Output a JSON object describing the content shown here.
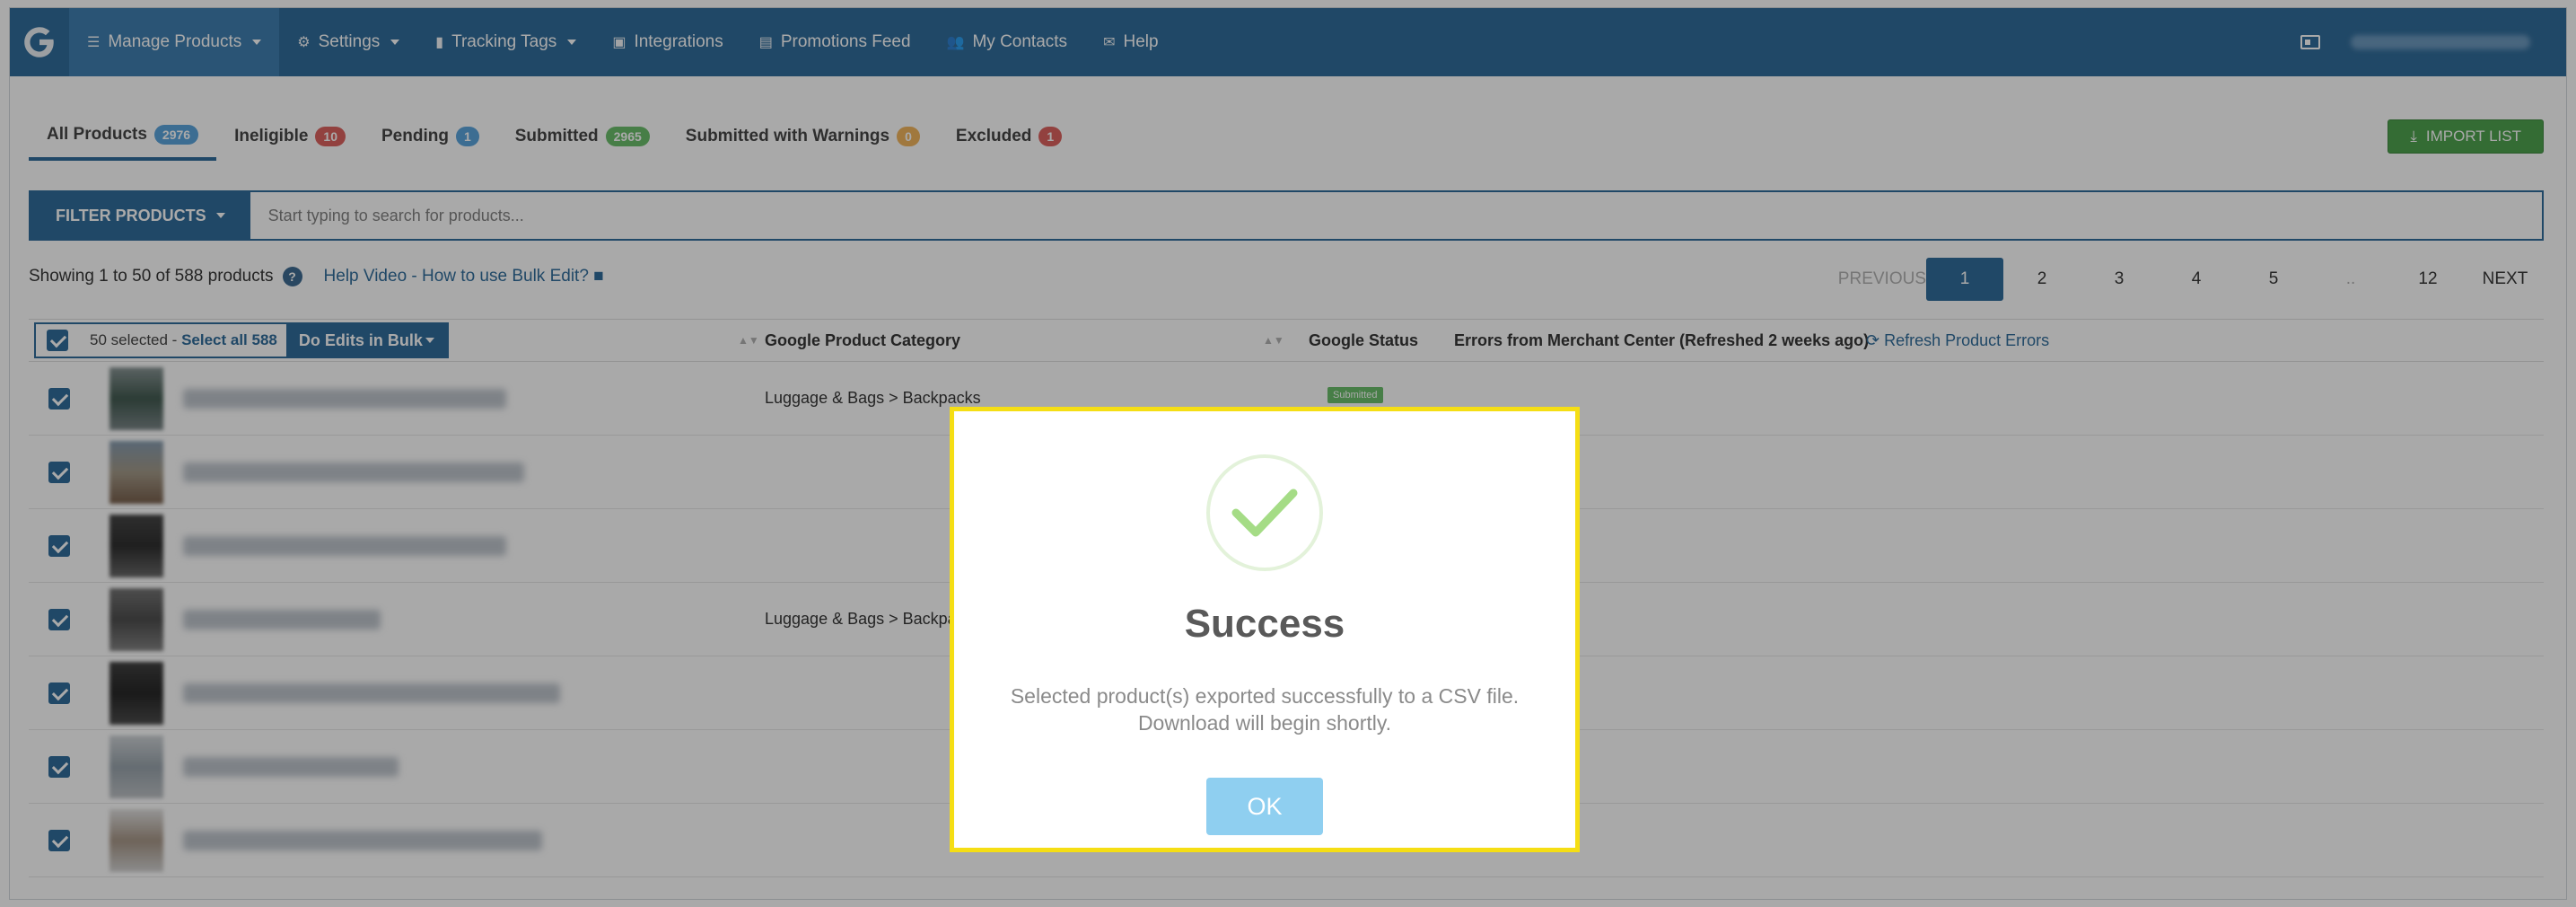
{
  "nav": {
    "items": [
      {
        "label": "Manage Products",
        "icon": "list-icon",
        "dropdown": true
      },
      {
        "label": "Settings",
        "icon": "gear-icon",
        "dropdown": true
      },
      {
        "label": "Tracking Tags",
        "icon": "bar-chart-icon",
        "dropdown": true
      },
      {
        "label": "Integrations",
        "icon": "briefcase-icon",
        "dropdown": false
      },
      {
        "label": "Promotions Feed",
        "icon": "document-icon",
        "dropdown": false
      },
      {
        "label": "My Contacts",
        "icon": "contacts-icon",
        "dropdown": false
      },
      {
        "label": "Help",
        "icon": "comment-icon",
        "dropdown": false
      }
    ]
  },
  "tabs": [
    {
      "label": "All Products",
      "count": "2976",
      "color": "#4a9bd9"
    },
    {
      "label": "Ineligible",
      "count": "10",
      "color": "#d9534f"
    },
    {
      "label": "Pending",
      "count": "1",
      "color": "#4a9bd9"
    },
    {
      "label": "Submitted",
      "count": "2965",
      "color": "#5cb85c"
    },
    {
      "label": "Submitted with Warnings",
      "count": "0",
      "color": "#f0ad4e"
    },
    {
      "label": "Excluded",
      "count": "1",
      "color": "#d9534f"
    }
  ],
  "import_label": "IMPORT LIST",
  "filter": {
    "label": "FILTER PRODUCTS",
    "placeholder": "Start typing to search for products..."
  },
  "info": {
    "showing": "Showing 1 to 50 of 588 products",
    "help_link": "Help Video - How to use Bulk Edit?"
  },
  "pager": [
    "PREVIOUS",
    "1",
    "2",
    "3",
    "4",
    "5",
    "..",
    "12",
    "NEXT"
  ],
  "table": {
    "selected": "50 selected - ",
    "select_all": "Select all 588",
    "bulk": "Do Edits in Bulk",
    "col_category": "Google Product Category",
    "col_status": "Google Status",
    "col_errors": "Errors from Merchant Center (Refreshed 2 weeks ago)",
    "refresh": "Refresh Product Errors",
    "rows": [
      {
        "category": "Luggage & Bags > Backpacks",
        "status": "Submitted"
      },
      {
        "category": "",
        "status": ""
      },
      {
        "category": "",
        "status": ""
      },
      {
        "category": "Luggage & Bags > Backpac",
        "status": ""
      },
      {
        "category": "",
        "status": ""
      },
      {
        "category": "",
        "status": ""
      },
      {
        "category": "",
        "status": ""
      }
    ]
  },
  "modal": {
    "title": "Success",
    "message": "Selected product(s) exported successfully to a CSV file. Download will begin shortly.",
    "ok": "OK"
  }
}
